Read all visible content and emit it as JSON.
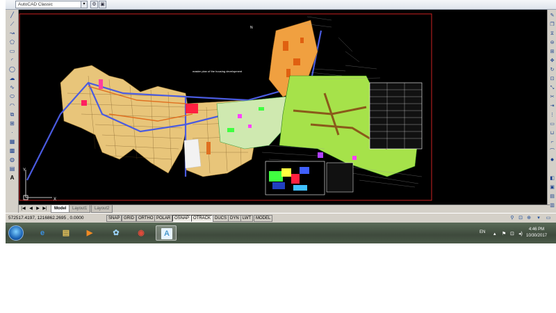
{
  "workspace": {
    "selected": "AutoCAD Classic",
    "dropdown_icon": "chevron-down-icon",
    "buttons": [
      "workspace-settings-icon",
      "toolbar-lock-icon"
    ]
  },
  "left_toolbar": {
    "tools": [
      "line-icon",
      "construction-line-icon",
      "polyline-icon",
      "polygon-icon",
      "rectangle-icon",
      "arc-icon",
      "circle-icon",
      "revision-cloud-icon",
      "spline-icon",
      "ellipse-icon",
      "ellipse-arc-icon",
      "insert-block-icon",
      "make-block-icon",
      "point-icon",
      "hatch-icon",
      "gradient-icon",
      "region-icon",
      "table-icon",
      "multiline-text-icon"
    ],
    "text_tool_label": "A"
  },
  "right_toolbar": {
    "tools": [
      "erase-icon",
      "copy-icon",
      "mirror-icon",
      "offset-icon",
      "array-icon",
      "move-icon",
      "rotate-icon",
      "scale-icon",
      "stretch-icon",
      "trim-icon",
      "extend-icon",
      "break-at-point-icon",
      "break-icon",
      "join-icon",
      "chamfer-icon",
      "fillet-icon",
      "explode-icon",
      "layer-icon",
      "properties-icon",
      "match-properties-icon",
      "layer-state-icon",
      "layer-previous-icon"
    ]
  },
  "drawing": {
    "plan_title": "master plan of the housing development",
    "ucs_x_label": "X",
    "ucs_y_label": "Y",
    "top_label": "N"
  },
  "layout_tabs": [
    "Model",
    "Layout1",
    "Layout2"
  ],
  "active_tab": "Model",
  "status": {
    "coordinates": "572517.4197, 1216862.2695 , 0.0000",
    "toggles": [
      {
        "label": "SNAP",
        "on": false
      },
      {
        "label": "GRID",
        "on": false
      },
      {
        "label": "ORTHO",
        "on": false
      },
      {
        "label": "POLAR",
        "on": false
      },
      {
        "label": "OSNAP",
        "on": true
      },
      {
        "label": "OTRACK",
        "on": true
      },
      {
        "label": "DUCS",
        "on": false
      },
      {
        "label": "DYN",
        "on": false
      },
      {
        "label": "LWT",
        "on": false
      },
      {
        "label": "MODEL",
        "on": false
      }
    ],
    "tray_icons": [
      "communication-center-icon",
      "toolbar-unlock-icon",
      "annotation-scale-icon",
      "clean-screen-icon"
    ]
  },
  "taskbar": {
    "apps": [
      {
        "name": "internet-explorer",
        "glyph": "e",
        "color": "#3a8fe0"
      },
      {
        "name": "file-explorer",
        "glyph": "▤",
        "color": "#e8c35a"
      },
      {
        "name": "media-player",
        "glyph": "▶",
        "color": "#f08a24"
      },
      {
        "name": "sync-app",
        "glyph": "✿",
        "color": "#9ad0f5"
      },
      {
        "name": "chrome",
        "glyph": "◉",
        "color": "#e04a3a"
      },
      {
        "name": "autocad",
        "glyph": "A",
        "color": "#4a9acc"
      }
    ],
    "language": "EN",
    "time": "4:46 PM",
    "date": "10/30/2017"
  }
}
